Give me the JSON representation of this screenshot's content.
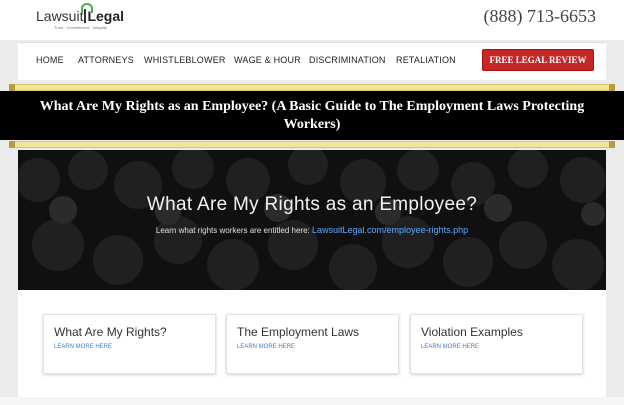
{
  "header": {
    "logo_word1": "Lawsuit",
    "logo_word2": "Legal",
    "logo_tagline": "Trust · Commitment · Integrity",
    "phone": "(888) 713-6653"
  },
  "nav": {
    "items": [
      "HOME",
      "ATTORNEYS",
      "WHISTLEBLOWER",
      "WAGE & HOUR",
      "DISCRIMINATION",
      "RETALIATION"
    ],
    "cta": "FREE LEGAL REVIEW"
  },
  "article": {
    "title": "What Are My Rights as an Employee? (A Basic Guide to The Employment Laws Protecting Workers)"
  },
  "hero": {
    "heading": "What Are My Rights as an Employee?",
    "subtext": "Learn what rights workers are entitled here:",
    "link": "LawsuitLegal.com/employee-rights.php"
  },
  "cards": [
    {
      "title": "What Are My Rights?",
      "link": "LEARN MORE HERE"
    },
    {
      "title": "The Employment Laws",
      "link": "LEARN MORE HERE"
    },
    {
      "title": "Violation Examples",
      "link": "LEARN MORE HERE"
    }
  ],
  "colors": {
    "cta_red": "#c62828",
    "title_bar": "#000000",
    "gold_rule": "#f1e59a",
    "link_blue": "#5ea9ff"
  }
}
